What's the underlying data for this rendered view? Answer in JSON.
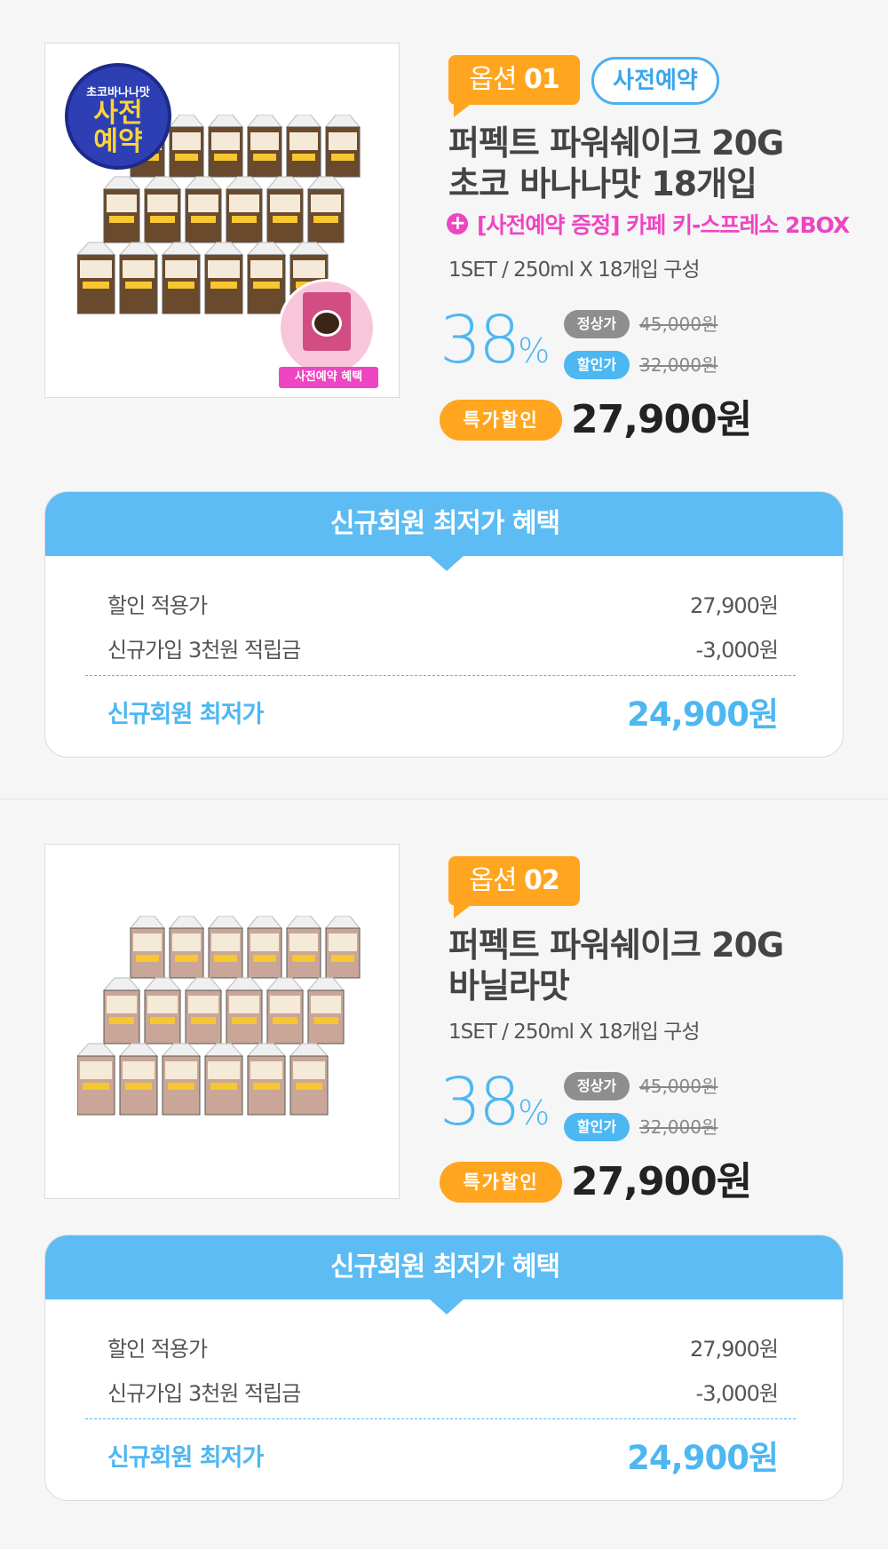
{
  "options": [
    {
      "option_word": "옵션",
      "option_number": "01",
      "preorder_pill": "사전예약",
      "title_line1": "퍼펙트 파워쉐이크 20G",
      "title_line2": "초코 바나나맛 18개입",
      "gift_line": "[사전예약 증정] 카페 키-스프레소 2BOX",
      "spec": "1SET / 250ml X  18개입 구성",
      "discount_percent": "38",
      "percent_sign": "%",
      "regular_label": "정상가",
      "regular_price": "45,000원",
      "sale_label": "할인가",
      "sale_price": "32,000원",
      "special_label": "특가할인",
      "final_price": "27,900원",
      "image": {
        "seal_small": "초코바나나맛",
        "seal_big_1": "사전",
        "seal_big_2": "예약",
        "gift_label": "사전예약 혜택",
        "pack_color": "#6a4a2c"
      }
    },
    {
      "option_word": "옵션",
      "option_number": "02",
      "title_line1": "퍼펙트 파워쉐이크 20G",
      "title_line2": "바닐라맛",
      "spec": "1SET / 250ml X  18개입 구성",
      "discount_percent": "38",
      "percent_sign": "%",
      "regular_label": "정상가",
      "regular_price": "45,000원",
      "sale_label": "할인가",
      "sale_price": "32,000원",
      "special_label": "특가할인",
      "final_price": "27,900원",
      "image": {
        "pack_color": "#c9a697"
      }
    }
  ],
  "benefit": {
    "header": "신규회원 최저가 혜택",
    "row1_label": "할인 적용가",
    "row1_value": "27,900원",
    "row2_label": "신규가입 3천원 적립금",
    "row2_value": "-3,000원",
    "total_label": "신규회원 최저가",
    "total_value": "24,900원"
  },
  "colors": {
    "accent_orange": "#ffa51f",
    "accent_blue": "#4db7f2",
    "gift_pink": "#ee45c2"
  }
}
